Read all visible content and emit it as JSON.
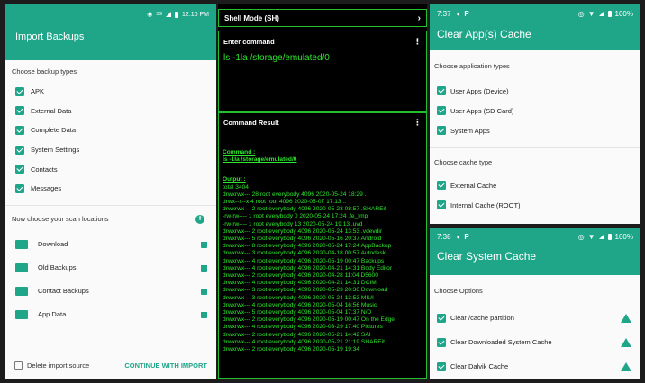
{
  "panel1": {
    "status_time": "12:10 PM",
    "status_net": "3G",
    "title": "Import Backups",
    "backup_types_header": "Choose backup types",
    "backup_types": [
      "APK",
      "External Data",
      "Complete Data",
      "System Settings",
      "Contacts",
      "Messages"
    ],
    "locations_header": "Now choose your scan locations",
    "locations": [
      "Download",
      "Old Backups",
      "Contact Backups",
      "App Data"
    ],
    "delete_label": "Delete import source",
    "continue_label": "CONTINUE WITH IMPORT"
  },
  "panel2": {
    "shell_mode": "Shell Mode (SH)",
    "enter_command_label": "Enter command",
    "command_value": "ls -1la /storage/emulated/0",
    "result_label": "Command Result",
    "command_heading": "Command :",
    "command_echo": "ls -1la /storage/emulated/0",
    "output_heading": "Output :",
    "output_lines": [
      "total 3404",
      "drwxrwx--- 28 root everybody 4096 2020-05-24 18:29 .",
      "drwx--x--x 4 root root 4096 2020-05-07 17:13 ..",
      "drwxrwx--- 2 root everybody 4096 2020-05-23 08:57 .SHAREit",
      "-rw-rw---- 1 root everybody 0 2020-05-24 17:24 .fe_tmp",
      "-rw-rw---- 1 root everybody 13 2020-05-24 19:13 .uvd",
      "drwxrwx--- 2 root everybody 4096 2020-05-24 13:53 .vdevdir",
      "drwxrwx--- 5 root everybody 4096 2020-05-16 20:37 Android",
      "drwxrwx--- 8 root everybody 4096 2020-05-24 17:24 AppBackup",
      "drwxrwx--- 3 root everybody 4096 2020-04-18 00:57 Autodesk",
      "drwxrwx--- 4 root everybody 4096 2020-05-19 00:47 Backups",
      "drwxrwx--- 4 root everybody 4096 2020-04-21 14:31 Body Editor",
      "drwxrwx--- 2 root everybody 4096 2020-04-28 11:04 D5600",
      "drwxrwx--- 4 root everybody 4096 2020-04-21 14:31 DCIM",
      "drwxrwx--- 3 root everybody 4096 2020-05-23 20:30 Download",
      "drwxrwx--- 3 root everybody 4096 2020-05-24 13:53 MIUI",
      "drwxrwx--- 4 root everybody 4096 2020-05-04 16:56 Music",
      "drwxrwx--- 5 root everybody 4096 2020-05-04 17:37 N/D",
      "drwxrwx--- 2 root everybody 4096 2020-05-19 00:47 On the Edge",
      "drwxrwx--- 4 root everybody 4096 2020-03-29 17:40 Pictures",
      "drwxrwx--- 2 root everybody 4096 2020-05-21 14:42 SAI",
      "drwxrwx--- 4 root everybody 4096 2020-05-21 21:19 SHAREit",
      "drwxrwx--- 2 root everybody 4096 2020-05-19 19:34"
    ]
  },
  "panel3": {
    "status_time": "7:37",
    "title": "Clear App(s) Cache",
    "app_types_header": "Choose application types",
    "app_types": [
      "User Apps (Device)",
      "User Apps (SD Card)",
      "System Apps"
    ],
    "cache_type_header": "Choose cache type",
    "cache_types": [
      "External Cache",
      "Internal Cache (ROOT)"
    ]
  },
  "panel4": {
    "status_time": "7:38",
    "title": "Clear System Cache",
    "options_header": "Choose Options",
    "options": [
      "Clear /cache partition",
      "Clear Downloaded System Cache",
      "Clear Dalvik Cache"
    ]
  },
  "colors": {
    "accent": "#1fa588",
    "terminal_green": "#2ee62e",
    "terminal_border": "#22c02f"
  }
}
